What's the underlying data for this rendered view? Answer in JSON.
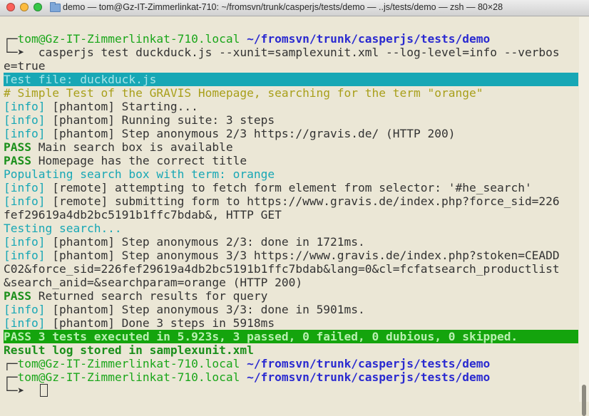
{
  "window": {
    "title": "demo — tom@Gz-IT-Zimmerlinkat-710: ~/fromsvn/trunk/casperjs/tests/demo — ..js/tests/demo — zsh — 80×28"
  },
  "colors": {
    "background": "#ebe7d6",
    "user_host": "#1aa61a",
    "path": "#2a2ad0",
    "info": "#17a7b5",
    "comment": "#a89f1a",
    "pass": "#1a8f1a",
    "highlight_cyan": "#17a7b5",
    "highlight_green": "#14a40d"
  },
  "terminal": {
    "prompt1": {
      "corner": "┌─",
      "userhost": "tom@Gz-IT-Zimmerlinkat-710.local",
      "path": "~/fromsvn/trunk/casperjs/tests/demo"
    },
    "command": {
      "arrow": "└─➤",
      "text": "  casperjs test duckduck.js --xunit=samplexunit.xml --log-level=info --verbos",
      "cont": "e=true"
    },
    "lines": [
      {
        "kind": "header",
        "text": "Test file: duckduck.js"
      },
      {
        "kind": "comment",
        "text": "# Simple Test of the GRAVIS Homepage, searching for the term \"orange\""
      },
      {
        "kind": "info",
        "tag": "[info]",
        "text": " [phantom] Starting..."
      },
      {
        "kind": "info",
        "tag": "[info]",
        "text": " [phantom] Running suite: 3 steps"
      },
      {
        "kind": "info",
        "tag": "[info]",
        "text": " [phantom] Step anonymous 2/3 https://gravis.de/ (HTTP 200)"
      },
      {
        "kind": "pass",
        "tag": "PASS",
        "text": " Main search box is available"
      },
      {
        "kind": "pass",
        "tag": "PASS",
        "text": " Homepage has the correct title"
      },
      {
        "kind": "cyan",
        "text": "Populating search box with term: orange"
      },
      {
        "kind": "info",
        "tag": "[info]",
        "text": " [remote] attempting to fetch form element from selector: '#he_search'"
      },
      {
        "kind": "info",
        "tag": "[info]",
        "text": " [remote] submitting form to https://www.gravis.de/index.php?force_sid=226"
      },
      {
        "kind": "plain",
        "text": "fef29619a4db2bc5191b1ffc7bdab&, HTTP GET"
      },
      {
        "kind": "cyan",
        "text": "Testing search..."
      },
      {
        "kind": "info",
        "tag": "[info]",
        "text": " [phantom] Step anonymous 2/3: done in 1721ms."
      },
      {
        "kind": "info",
        "tag": "[info]",
        "text": " [phantom] Step anonymous 3/3 https://www.gravis.de/index.php?stoken=CEADD"
      },
      {
        "kind": "plain",
        "text": "C02&force_sid=226fef29619a4db2bc5191b1ffc7bdab&lang=0&cl=fcfatsearch_productlist"
      },
      {
        "kind": "plain",
        "text": "&search_anid=&searchparam=orange (HTTP 200)"
      },
      {
        "kind": "pass",
        "tag": "PASS",
        "text": " Returned search results for query"
      },
      {
        "kind": "info",
        "tag": "[info]",
        "text": " [phantom] Step anonymous 3/3: done in 5901ms."
      },
      {
        "kind": "info",
        "tag": "[info]",
        "text": " [phantom] Done 3 steps in 5918ms"
      },
      {
        "kind": "summary",
        "text": "PASS 3 tests executed in 5.923s, 3 passed, 0 failed, 0 dubious, 0 skipped. "
      },
      {
        "kind": "result",
        "text": "Result log stored in samplexunit.xml"
      }
    ],
    "prompt2": {
      "corner": "┌─",
      "userhost": "tom@Gz-IT-Zimmerlinkat-710.local",
      "path": "~/fromsvn/trunk/casperjs/tests/demo"
    },
    "prompt3": {
      "corner": "┌─",
      "userhost": "tom@Gz-IT-Zimmerlinkat-710.local",
      "path": "~/fromsvn/trunk/casperjs/tests/demo",
      "arrow": "└─➤"
    }
  }
}
